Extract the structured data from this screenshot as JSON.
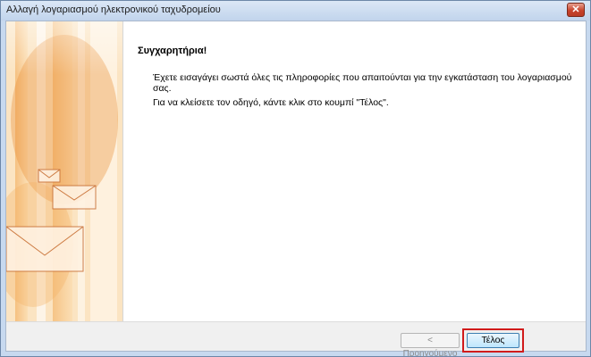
{
  "window": {
    "title": "Αλλαγή λογαριασμού ηλεκτρονικού ταχυδρομείου",
    "close_icon": "close-icon"
  },
  "side_panel": {
    "image": "envelopes-illustration",
    "accent_colors": [
      "#f6c98a",
      "#e58b2d",
      "#fff3e2"
    ]
  },
  "content": {
    "heading": "Συγχαρητήρια!",
    "message": "Έχετε εισαγάγει σωστά όλες τις πληροφορίες που απαιτούνται για την εγκατάσταση του λογαριασμού σας.",
    "instruction": "Για να κλείσετε τον οδηγό, κάντε κλικ στο κουμπί \"Τέλος\"."
  },
  "footer": {
    "prev_label": "< Προηγούμενο",
    "finish_label": "Τέλος",
    "highlight_color": "#d11b1b"
  }
}
